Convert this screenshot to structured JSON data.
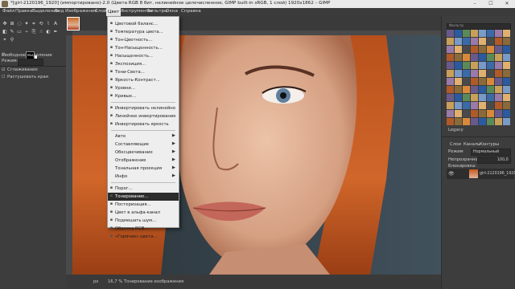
{
  "window": {
    "title": "*[girl-2120196_1920] (импортировано)-2.0 (Цвета RGB 8 бит, нелинейное целочисленное, GIMP built-in sRGB, 1 слой) 1920x1862 – GIMP",
    "minimize": "–",
    "maximize": "☐",
    "close": "✕"
  },
  "menubar": {
    "items": [
      "Файл",
      "Правка",
      "Выделение",
      "Вид",
      "Изображение",
      "Слой",
      "Цвет",
      "Инструменты",
      "Фильтры",
      "Окна",
      "Справка"
    ],
    "active": "Цвет"
  },
  "toolbox": {
    "tool_options_title": "Свободное выделение",
    "mode_label": "Режим:",
    "antialias_label": "Сглаживание",
    "feather_label": "Растушевать края"
  },
  "color_menu": {
    "items": [
      {
        "label": "Цветовой баланс...",
        "icon": "balance-icon"
      },
      {
        "label": "Температура цвета...",
        "icon": "temperature-icon"
      },
      {
        "label": "Тон-Цветность...",
        "icon": "hue-chroma-icon"
      },
      {
        "label": "Тон-Насыщенность...",
        "icon": "hue-saturation-icon"
      },
      {
        "label": "Насыщенность...",
        "icon": "saturation-icon"
      },
      {
        "label": "Экспозиция...",
        "icon": "exposure-icon"
      },
      {
        "label": "Тени-Света...",
        "icon": "shadows-highlights-icon"
      },
      {
        "label": "Яркость-Контраст...",
        "icon": "brightness-contrast-icon"
      },
      {
        "label": "Уровни...",
        "icon": "levels-icon"
      },
      {
        "label": "Кривые...",
        "icon": "curves-icon"
      },
      {
        "label": "Инвертировать нелинейно",
        "icon": "invert-icon"
      },
      {
        "label": "Линейное инвертирование",
        "icon": "linear-invert-icon"
      },
      {
        "label": "Инвертировать яркость",
        "icon": "value-invert-icon"
      },
      {
        "label": "Авто",
        "submenu": true
      },
      {
        "label": "Составляющие",
        "submenu": true
      },
      {
        "label": "Обесцвечивание",
        "submenu": true
      },
      {
        "label": "Отображение",
        "submenu": true
      },
      {
        "label": "Тональная проекция",
        "submenu": true
      },
      {
        "label": "Инфо",
        "submenu": true
      },
      {
        "label": "Порог...",
        "icon": "threshold-icon"
      },
      {
        "label": "Тонирование...",
        "icon": "colorize-icon",
        "highlighted": true
      },
      {
        "label": "Постеризация...",
        "icon": "posterize-icon"
      },
      {
        "label": "Цвет в альфа-канал",
        "icon": "color-to-alpha-icon"
      },
      {
        "label": "Подмешать шум...",
        "icon": "dither-icon"
      },
      {
        "label": "Обрезка RGB...",
        "icon": "rgb-clip-icon"
      },
      {
        "label": "«Горячие» цвета...",
        "icon": "hot-colors-icon"
      }
    ]
  },
  "status": {
    "unit": "px",
    "zoom": "16,7 %",
    "message": "Тонирование изображения"
  },
  "right_dock": {
    "filter_placeholder": "Фильтр",
    "brush_tag": "Legacy",
    "tabs": [
      "Слои",
      "Каналы",
      "Контуры"
    ],
    "mode_label": "Режим",
    "mode_value": "Нормальный",
    "opacity_label": "Непрозрачность",
    "opacity_value": "100,0",
    "lock_label": "Блокировка:",
    "layer_name": "girl-2120196_1920"
  },
  "colors": {
    "hair": "#c8581e",
    "skin": "#e2b49a",
    "background": "#3a4a56"
  }
}
